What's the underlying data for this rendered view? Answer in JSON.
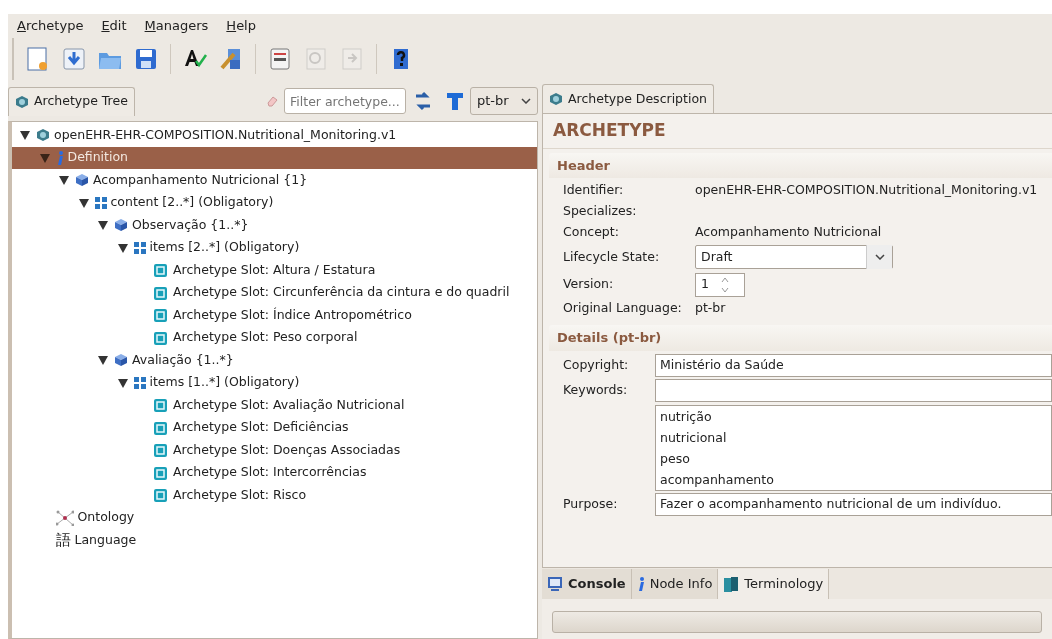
{
  "menu": [
    {
      "label": "Archetype"
    },
    {
      "label": "Edit"
    },
    {
      "label": "Managers"
    },
    {
      "label": "Help"
    }
  ],
  "toolbar": [
    [
      {
        "kind": "new",
        "disabled": false
      },
      {
        "kind": "import",
        "disabled": false
      },
      {
        "kind": "open",
        "disabled": false
      },
      {
        "kind": "save",
        "disabled": false
      }
    ],
    [
      {
        "kind": "validate",
        "disabled": false
      },
      {
        "kind": "tools",
        "disabled": false
      }
    ],
    [
      {
        "kind": "adl",
        "disabled": false
      },
      {
        "kind": "inspect",
        "disabled": true
      },
      {
        "kind": "export",
        "disabled": true
      }
    ],
    [
      {
        "kind": "help",
        "disabled": false
      }
    ]
  ],
  "tree_panel": {
    "tab": {
      "label": "Archetype Tree",
      "selected": true
    },
    "filter": {
      "placeholder": "Filter archetype..."
    },
    "language": "pt-br",
    "tree": [
      {
        "label": "openEHR-EHR-COMPOSITION.Nutritional_Monitoring.v1",
        "kind": "archetype",
        "expanded": true,
        "selected": false,
        "children": [
          {
            "label": "Definition",
            "kind": "definition",
            "expanded": true,
            "selected": true,
            "children": [
              {
                "label": "Acompanhamento Nutricional {1}",
                "kind": "object",
                "expanded": true,
                "selected": false,
                "children": [
                  {
                    "label": "content [2..*] (Obligatory)",
                    "kind": "attribute",
                    "expanded": true,
                    "selected": false,
                    "children": [
                      {
                        "label": "Observação {1..*}",
                        "kind": "object",
                        "expanded": true,
                        "selected": false,
                        "children": [
                          {
                            "label": "items [2..*] (Obligatory)",
                            "kind": "attribute",
                            "expanded": true,
                            "selected": false,
                            "children": [
                              {
                                "label": "Archetype Slot: Altura / Estatura",
                                "kind": "slot",
                                "selected": false
                              },
                              {
                                "label": "Archetype Slot: Circunferência da cintura e do quadril",
                                "kind": "slot",
                                "selected": false
                              },
                              {
                                "label": "Archetype Slot: Índice Antropométrico",
                                "kind": "slot",
                                "selected": false
                              },
                              {
                                "label": "Archetype Slot: Peso corporal",
                                "kind": "slot",
                                "selected": false
                              }
                            ]
                          }
                        ]
                      },
                      {
                        "label": "Avaliação {1..*}",
                        "kind": "object",
                        "expanded": true,
                        "selected": false,
                        "children": [
                          {
                            "label": "items [1..*] (Obligatory)",
                            "kind": "attribute",
                            "expanded": true,
                            "selected": false,
                            "children": [
                              {
                                "label": "Archetype Slot: Avaliação Nutricional",
                                "kind": "slot",
                                "selected": false
                              },
                              {
                                "label": "Archetype Slot: Deficiências",
                                "kind": "slot",
                                "selected": false
                              },
                              {
                                "label": "Archetype Slot: Doenças Associadas",
                                "kind": "slot",
                                "selected": false
                              },
                              {
                                "label": "Archetype Slot: Intercorrências",
                                "kind": "slot",
                                "selected": false
                              },
                              {
                                "label": "Archetype Slot: Risco",
                                "kind": "slot",
                                "selected": false
                              }
                            ]
                          }
                        ]
                      }
                    ]
                  }
                ]
              }
            ]
          },
          {
            "label": "Ontology",
            "kind": "ontology",
            "selected": false
          },
          {
            "label": "Language",
            "kind": "language",
            "icon_char": "語",
            "selected": false
          }
        ]
      }
    ]
  },
  "description_panel": {
    "tab": {
      "label": "Archetype Description",
      "selected": true
    },
    "heading": "ARCHETYPE",
    "header": {
      "title": "Header",
      "fields": [
        {
          "label": "Identifier:",
          "kind": "text",
          "value": "openEHR-EHR-COMPOSITION.Nutritional_Monitoring.v1"
        },
        {
          "label": "Specializes:",
          "kind": "text"
        },
        {
          "label": "Concept:",
          "kind": "text",
          "value": "Acompanhamento Nutricional"
        },
        {
          "label": "Lifecycle State:",
          "kind": "select",
          "value": "Draft"
        },
        {
          "label": "Version:",
          "kind": "spinner",
          "value": "1"
        },
        {
          "label": "Original Language:",
          "kind": "text",
          "value": "pt-br"
        }
      ]
    },
    "details": {
      "title": "Details  (pt-br)",
      "fields": [
        {
          "label": "Copyright:",
          "kind": "input",
          "value": "Ministério da Saúde"
        },
        {
          "label": "Keywords:",
          "kind": "input"
        },
        {
          "kind": "list",
          "items": [
            "nutrição",
            "nutricional",
            "peso",
            "acompanhamento"
          ]
        },
        {
          "label": "Purpose:",
          "kind": "input",
          "value": "Fazer o acompanhamento nutricional de um indivíduo."
        }
      ]
    }
  },
  "bottom_tabs": [
    {
      "label": "Console",
      "kind": "console",
      "bold": true,
      "selected": false
    },
    {
      "label": "Node Info",
      "kind": "info",
      "bold": false,
      "selected": false
    },
    {
      "label": "Terminology",
      "kind": "terminology",
      "bold": false,
      "selected": true
    }
  ]
}
